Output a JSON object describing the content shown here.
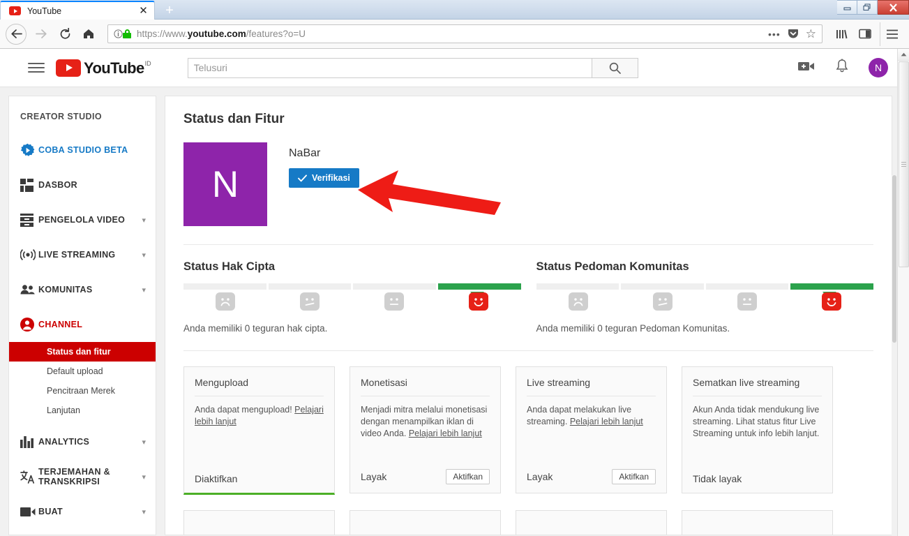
{
  "browser": {
    "tab": {
      "title": "YouTube",
      "favicon": "youtube-favicon",
      "close": "✕"
    },
    "newtab_label": "+",
    "window_controls": {
      "minimize": "minimize-icon",
      "restore": "restore-icon",
      "close": "close-icon"
    },
    "nav": {
      "back": "←",
      "forward": "→",
      "reload": "↻",
      "home": "home-icon"
    },
    "url": {
      "scheme": "https://www.",
      "domain": "youtube.com",
      "path": "/features?o=U",
      "full": "https://www.youtube.com/features?o=U"
    },
    "url_actions": {
      "more": "•••",
      "pocket": "pocket-icon",
      "bookmark": "☆"
    },
    "toolbar_right": {
      "library": "library-icon",
      "sidebar": "sidebar-icon",
      "menu": "≡"
    }
  },
  "yt_header": {
    "menu": "hamburger-icon",
    "logo_text": "YouTube",
    "country_code": "ID",
    "search": {
      "placeholder": "Telusuri",
      "value": "",
      "button": "search-icon"
    },
    "create": "video-camera-icon",
    "notifications": "bell-icon",
    "avatar_letter": "N"
  },
  "sidebar": {
    "heading": "CREATOR STUDIO",
    "items": [
      {
        "label": "COBA STUDIO BETA",
        "icon": "gear-play-icon",
        "expandable": false
      },
      {
        "label": "DASBOR",
        "icon": "dashboard-icon",
        "expandable": false
      },
      {
        "label": "PENGELOLA VIDEO",
        "icon": "video-manager-icon",
        "expandable": true
      },
      {
        "label": "LIVE STREAMING",
        "icon": "broadcast-icon",
        "expandable": true
      },
      {
        "label": "KOMUNITAS",
        "icon": "people-icon",
        "expandable": true
      },
      {
        "label": "CHANNEL",
        "icon": "person-circle-icon",
        "expandable": false
      },
      {
        "label": "ANALYTICS",
        "icon": "bar-chart-icon",
        "expandable": true
      },
      {
        "label": "TERJEMAHAN & TRANSKRIPSI",
        "icon": "translate-icon",
        "expandable": true
      },
      {
        "label": "BUAT",
        "icon": "movie-camera-icon",
        "expandable": true
      }
    ],
    "channel_subitems": [
      {
        "label": "Status dan fitur",
        "active": true
      },
      {
        "label": "Default upload",
        "active": false
      },
      {
        "label": "Pencitraan Merek",
        "active": false
      },
      {
        "label": "Lanjutan",
        "active": false
      }
    ]
  },
  "main": {
    "title": "Status dan Fitur",
    "channel": {
      "avatar_letter": "N",
      "name": "NaBar",
      "verify_button": "Verifikasi",
      "verify_icon": "check-icon",
      "annotation": "red-arrow-pointing-to-verify-button"
    },
    "copyright": {
      "title": "Status Hak Cipta",
      "note": "Anda memiliki 0 teguran hak cipta.",
      "segments": [
        false,
        false,
        false,
        true
      ],
      "faces": [
        "sad-face-icon",
        "frown-face-icon",
        "neutral-face-icon",
        "happy-face-icon"
      ],
      "active_face_index": 3
    },
    "community": {
      "title": "Status Pedoman Komunitas",
      "note": "Anda memiliki 0 teguran Pedoman Komunitas.",
      "segments": [
        false,
        false,
        false,
        true
      ],
      "faces": [
        "sad-face-icon",
        "frown-face-icon",
        "neutral-face-icon",
        "happy-face-icon"
      ],
      "active_face_index": 3
    },
    "cards": [
      {
        "title": "Mengupload",
        "desc_before": "Anda dapat mengupload! ",
        "link": "Pelajari lebih lanjut",
        "desc_after": "",
        "status": "Diaktifkan",
        "action": "",
        "enabled": true
      },
      {
        "title": "Monetisasi",
        "desc_before": "Menjadi mitra melalui monetisasi dengan menampilkan iklan di video Anda. ",
        "link": "Pelajari lebih lanjut",
        "desc_after": "",
        "status": "Layak",
        "action": "Aktifkan",
        "enabled": false
      },
      {
        "title": "Live streaming",
        "desc_before": "Anda dapat melakukan live streaming. ",
        "link": "Pelajari lebih lanjut",
        "desc_after": "",
        "status": "Layak",
        "action": "Aktifkan",
        "enabled": false
      },
      {
        "title": "Sematkan live streaming",
        "desc_before": "Akun Anda tidak mendukung live streaming. Lihat status fitur Live Streaming untuk info lebih lanjut.",
        "link": "",
        "desc_after": "",
        "status": "Tidak layak",
        "action": "",
        "enabled": false
      }
    ]
  },
  "colors": {
    "youtube_red": "#e62117",
    "accent_blue": "#167ac6",
    "status_green": "#2ba24c",
    "enabled_green": "#4caf26",
    "avatar_purple": "#8e24aa",
    "annotation_red": "#ee1c16"
  }
}
